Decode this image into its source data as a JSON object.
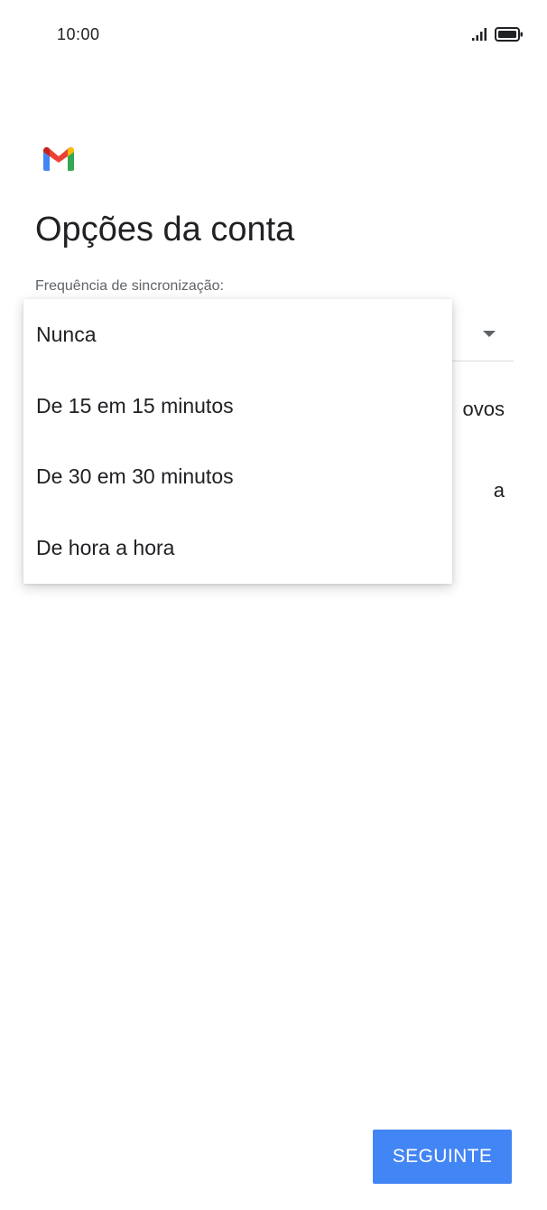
{
  "status_bar": {
    "time": "10:00",
    "signal_icon": "signal-bars-icon",
    "battery_icon": "battery-icon"
  },
  "app": {
    "logo_icon": "gmail-logo-icon",
    "logo_colors": {
      "red": "#ea4335",
      "blue": "#4285f4",
      "green": "#34a853",
      "yellow": "#fbbc04",
      "dark_red": "#c5221f"
    }
  },
  "page": {
    "title": "Opções da conta",
    "sync_label": "Frequência de sincronização:"
  },
  "background_rows": {
    "row1_visible_text": "ovos",
    "row2_visible_text": "a"
  },
  "dropdown": {
    "options": [
      {
        "label": "Nunca"
      },
      {
        "label": "De 15 em 15 minutos"
      },
      {
        "label": "De 30 em 30 minutos"
      },
      {
        "label": "De hora a hora"
      }
    ]
  },
  "footer": {
    "next_label": "SEGUINTE",
    "accent_color": "#4285f4"
  }
}
